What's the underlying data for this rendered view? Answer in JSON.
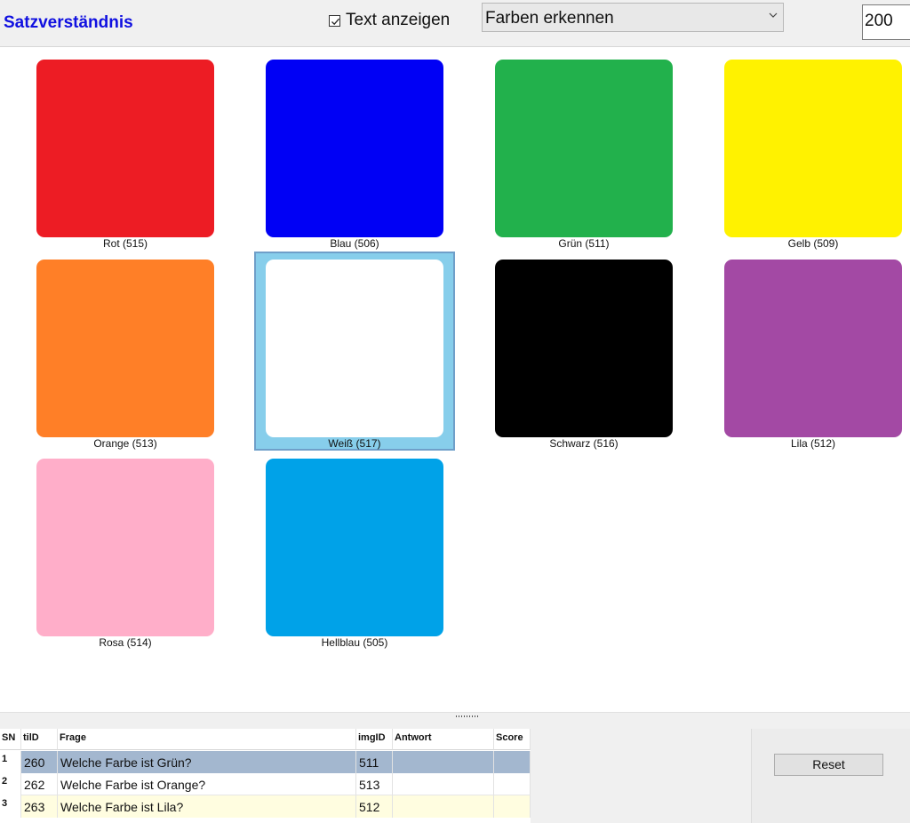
{
  "header": {
    "title": "Satzverständnis",
    "show_text_label": "Text anzeigen",
    "show_text_checked": true,
    "category_selected": "Farben erkennen",
    "size_value": "200"
  },
  "tiles": [
    {
      "label": "Rot (515)",
      "color": "#ed1c24"
    },
    {
      "label": "Blau (506)",
      "color": "#0000f5"
    },
    {
      "label": "Grün (511)",
      "color": "#22b14c"
    },
    {
      "label": "Gelb (509)",
      "color": "#fff200"
    },
    {
      "label": "Orange (513)",
      "color": "#ff7f27"
    },
    {
      "label": "Weiß (517)",
      "color": "#ffffff",
      "selected": true
    },
    {
      "label": "Schwarz (516)",
      "color": "#000000"
    },
    {
      "label": "Lila (512)",
      "color": "#a349a4"
    },
    {
      "label": "Rosa (514)",
      "color": "#ffaec9"
    },
    {
      "label": "Hellblau (505)",
      "color": "#00a2e8"
    }
  ],
  "table": {
    "columns": [
      "SN",
      "tilD",
      "Frage",
      "imgID",
      "Antwort",
      "Score"
    ],
    "rows": [
      {
        "sn": "1",
        "til": "260",
        "frage": "Welche Farbe ist Grün?",
        "img": "511",
        "antwort": "",
        "score": ""
      },
      {
        "sn": "2",
        "til": "262",
        "frage": "Welche Farbe ist Orange?",
        "img": "513",
        "antwort": "",
        "score": ""
      },
      {
        "sn": "3",
        "til": "263",
        "frage": "Welche Farbe ist Lila?",
        "img": "512",
        "antwort": "",
        "score": ""
      }
    ]
  },
  "reset_label": "Reset"
}
